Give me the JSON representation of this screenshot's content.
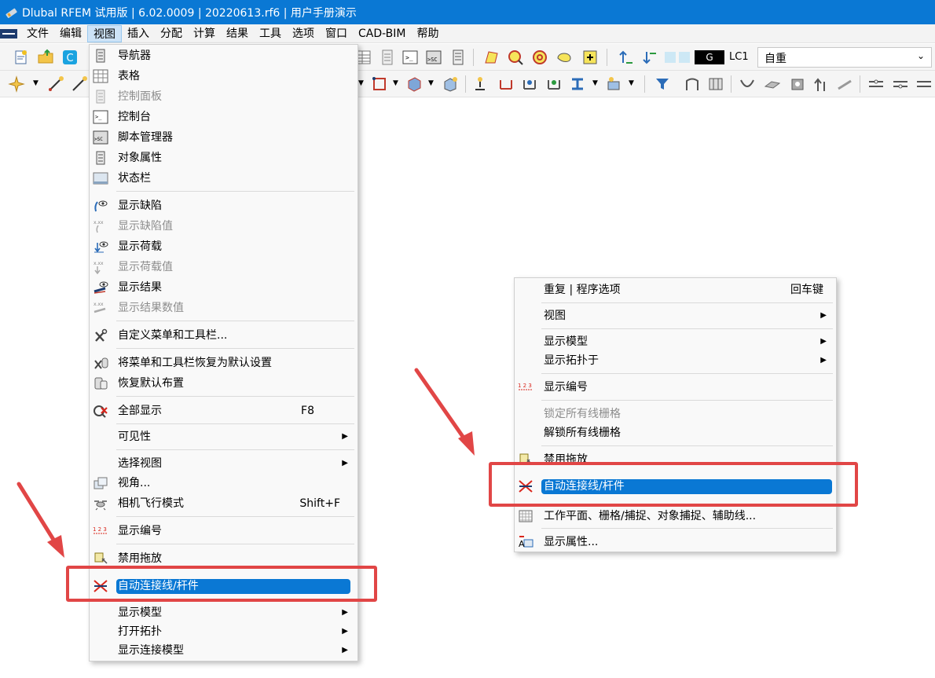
{
  "window": {
    "title": "Dlubal RFEM 试用版 | 6.02.0009 | 20220613.rf6 | 用户手册演示",
    "accent_color": "#0a78d4"
  },
  "menubar": {
    "items": [
      "文件",
      "编辑",
      "视图",
      "插入",
      "分配",
      "计算",
      "结果",
      "工具",
      "选项",
      "窗口",
      "CAD-BIM",
      "帮助"
    ],
    "active_index": 2
  },
  "toolbar": {
    "loadcase_color_label": "G",
    "loadcase_id": "LC1",
    "loadcase_name": "自重"
  },
  "view_menu": {
    "items": [
      {
        "label": "导航器",
        "icon": "navigator-icon",
        "disabled": false
      },
      {
        "label": "表格",
        "icon": "table-icon",
        "disabled": false
      },
      {
        "label": "控制面板",
        "icon": "control-panel-icon",
        "disabled": true
      },
      {
        "label": "控制台",
        "icon": "console-icon",
        "disabled": false
      },
      {
        "label": "脚本管理器",
        "icon": "script-manager-icon",
        "disabled": false
      },
      {
        "label": "对象属性",
        "icon": "object-properties-icon",
        "disabled": false
      },
      {
        "label": "状态栏",
        "icon": "status-bar-icon",
        "disabled": false
      },
      {
        "label": "显示缺陷",
        "icon": "show-imperfection-icon",
        "disabled": false
      },
      {
        "label": "显示缺陷值",
        "icon": "imperfection-values-icon",
        "disabled": true
      },
      {
        "label": "显示荷载",
        "icon": "show-loads-icon",
        "disabled": false
      },
      {
        "label": "显示荷载值",
        "icon": "load-values-icon",
        "disabled": true
      },
      {
        "label": "显示结果",
        "icon": "show-results-icon",
        "disabled": false
      },
      {
        "label": "显示结果数值",
        "icon": "result-values-icon",
        "disabled": true
      },
      {
        "label": "自定义菜单和工具栏...",
        "icon": "customize-tools-icon",
        "disabled": false
      },
      {
        "label": "将菜单和工具栏恢复为默认设置",
        "icon": "reset-tools-icon",
        "disabled": false
      },
      {
        "label": "恢复默认布置",
        "icon": "restore-layout-icon",
        "disabled": false
      },
      {
        "label": "全部显示",
        "icon": "show-all-icon",
        "shortcut": "F8",
        "disabled": false
      },
      {
        "label": "可见性",
        "submenu": true,
        "disabled": false
      },
      {
        "label": "选择视图",
        "submenu": true,
        "disabled": false
      },
      {
        "label": "视角...",
        "icon": "view-angle-icon",
        "disabled": false
      },
      {
        "label": "相机飞行模式",
        "icon": "camera-fly-icon",
        "shortcut": "Shift+F",
        "disabled": false
      },
      {
        "label": "显示编号",
        "icon": "numbering-icon",
        "disabled": false
      },
      {
        "label": "禁用拖放",
        "icon": "disable-drag-icon",
        "disabled": false
      },
      {
        "label": "自动连接线/杆件",
        "icon": "auto-connect-icon",
        "disabled": false,
        "selected": true
      },
      {
        "label": "显示模型",
        "submenu": true,
        "disabled": false
      },
      {
        "label": "打开拓扑",
        "submenu": true,
        "disabled": false
      },
      {
        "label": "显示连接模型",
        "submenu": true,
        "disabled": false
      }
    ]
  },
  "context_menu": {
    "items": [
      {
        "label": "重复 | 程序选项",
        "shortcut": "回车键",
        "disabled": false
      },
      {
        "label": "视图",
        "submenu": true,
        "disabled": false
      },
      {
        "label": "显示模型",
        "submenu": true,
        "disabled": false
      },
      {
        "label": "显示拓扑于",
        "submenu": true,
        "disabled": false
      },
      {
        "label": "显示编号",
        "icon": "numbering-icon",
        "disabled": false
      },
      {
        "label": "锁定所有线栅格",
        "disabled": true
      },
      {
        "label": "解锁所有线栅格",
        "disabled": false
      },
      {
        "label": "禁用拖放",
        "icon": "disable-drag-icon",
        "disabled": false
      },
      {
        "label": "自动连接线/杆件",
        "icon": "auto-connect-icon",
        "disabled": false,
        "selected": true
      },
      {
        "label": "工作平面、栅格/捕捉、对象捕捉、辅助线...",
        "icon": "work-plane-grid-icon",
        "disabled": false
      },
      {
        "label": "显示属性...",
        "icon": "display-properties-icon",
        "disabled": false
      }
    ]
  },
  "annotation_color": "#e14646"
}
